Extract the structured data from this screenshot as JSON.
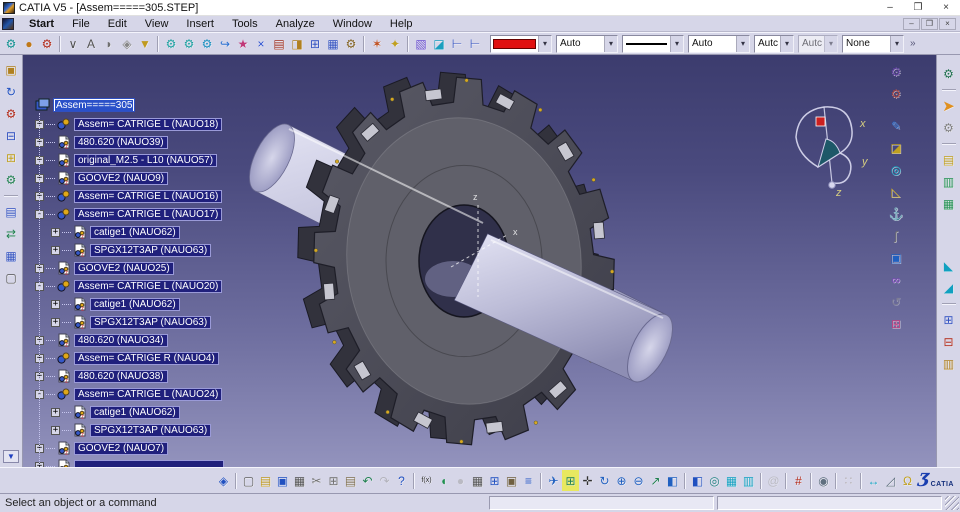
{
  "window": {
    "title": "CATIA V5 - [Assem=====305.STEP]",
    "min": "–",
    "restore": "❐",
    "close": "×"
  },
  "menu": {
    "items": [
      "Start",
      "File",
      "Edit",
      "View",
      "Insert",
      "Tools",
      "Analyze",
      "Window",
      "Help"
    ]
  },
  "glyphs": {
    "combo_arrow": "▾",
    "overflow_right": "»",
    "overflow_left": "▼",
    "expand": "+",
    "collapse": "-"
  },
  "toolbar_top": {
    "groups": [
      [
        {
          "n": "update-icon",
          "g": "⚙",
          "fg": "#0e8f8f"
        },
        {
          "n": "visual-sphere-icon",
          "g": "●",
          "fg": "#c07818"
        },
        {
          "n": "generate-gears-icon",
          "g": "⚙",
          "fg": "#b02818"
        }
      ],
      [
        {
          "n": "axis-snap-icon",
          "g": "∨",
          "fg": "#505050"
        },
        {
          "n": "text-annotation-icon",
          "g": "A",
          "fg": "#505050"
        },
        {
          "n": "callout-icon",
          "g": "◗",
          "fg": "#707070"
        },
        {
          "n": "clipping-icon",
          "g": "◈",
          "fg": "#888888"
        },
        {
          "n": "material-bucket-icon",
          "g": "▼",
          "fg": "#c09a20"
        }
      ],
      [
        {
          "n": "new-component-icon",
          "g": "⚙",
          "fg": "#1a9f9f"
        },
        {
          "n": "new-product-icon",
          "g": "⚙",
          "fg": "#1a9f9f"
        },
        {
          "n": "new-part-icon",
          "g": "⚙",
          "fg": "#1a8fbf"
        },
        {
          "n": "existing-component-icon",
          "g": "↪",
          "fg": "#2a6fd0"
        },
        {
          "n": "existing-with-positioning-icon",
          "g": "★",
          "fg": "#c03878"
        },
        {
          "n": "fast-multi-instantiation-icon",
          "g": "×",
          "fg": "#2a4fd0"
        },
        {
          "n": "catalog-book-icon",
          "g": "▤",
          "fg": "#a03020"
        },
        {
          "n": "smart-move-icon",
          "g": "◨",
          "fg": "#b08020"
        },
        {
          "n": "graph-tree-icon",
          "g": "⊞",
          "fg": "#3050c0"
        },
        {
          "n": "tree-window-icon",
          "g": "▦",
          "fg": "#3050c0"
        },
        {
          "n": "multi-instance-gear-icon",
          "g": "⚙",
          "fg": "#806020"
        }
      ],
      [
        {
          "n": "clash-icon",
          "g": "✶",
          "fg": "#c05020"
        },
        {
          "n": "sectioning-icon",
          "g": "✦",
          "fg": "#c0a020"
        }
      ],
      [
        {
          "n": "scene-box-icon",
          "g": "▧",
          "fg": "#6a4fd0"
        },
        {
          "n": "exploded-view-icon",
          "g": "◪",
          "fg": "#1a9fbf"
        },
        {
          "n": "structure-tree1-icon",
          "g": "⊢",
          "fg": "#3050c0"
        },
        {
          "n": "structure-tree2-icon",
          "g": "⊢",
          "fg": "#3050c0"
        }
      ]
    ],
    "combos": [
      {
        "n": "fill-color-combo",
        "kind": "color"
      },
      {
        "n": "opacity-combo",
        "value": "Auto"
      },
      {
        "n": "line-type-combo",
        "kind": "line"
      },
      {
        "n": "line-weight-combo",
        "value": "Auto"
      },
      {
        "n": "point-symbol-combo",
        "value": "Autc",
        "narrow": true
      },
      {
        "n": "render-style-combo",
        "value": "Autc",
        "narrow": true,
        "disabled": true
      },
      {
        "n": "layer-combo",
        "value": "None"
      }
    ]
  },
  "left_toolbar": {
    "icons": [
      {
        "n": "component-icon",
        "g": "▣",
        "fg": "#b08020"
      },
      {
        "n": "update-rotate-icon",
        "g": "↻",
        "fg": "#2050c0"
      },
      {
        "n": "part-gear-icon",
        "g": "⚙",
        "fg": "#b02818"
      },
      {
        "n": "product-structure-icon",
        "g": "⊟",
        "fg": "#3050c0"
      },
      {
        "n": "structure-bulb-icon",
        "g": "⊞",
        "fg": "#c0a020"
      },
      {
        "n": "constraints-gear-icon",
        "g": "⚙",
        "fg": "#208050"
      },
      {
        "sep": 1
      },
      {
        "n": "tree-edit-icon",
        "g": "▤",
        "fg": "#3050c0"
      },
      {
        "n": "replace-icon",
        "g": "⇄",
        "fg": "#208050"
      },
      {
        "n": "graph-list-icon",
        "g": "▦",
        "fg": "#3050c0"
      },
      {
        "n": "document-icon",
        "g": "▢",
        "fg": "#505050"
      }
    ]
  },
  "right_outer": {
    "icons": [
      {
        "n": "gears-pair-icon",
        "g": "⚙",
        "fg": "#207050"
      },
      {
        "sep": 1
      },
      {
        "n": "select-arrow-icon",
        "g": "➤",
        "fg": "#e09020",
        "big": 1
      },
      {
        "n": "gear-cursor-icon",
        "g": "⚙",
        "fg": "#808080"
      },
      {
        "sep": 1
      },
      {
        "n": "catalog-yellow-icon",
        "g": "▤",
        "fg": "#c0a020"
      },
      {
        "n": "catalog-green-icon",
        "g": "▥",
        "fg": "#209050"
      },
      {
        "n": "catalog-green2-icon",
        "g": "▦",
        "fg": "#209050"
      },
      {
        "gap": 40
      },
      {
        "n": "view-plane1-icon",
        "g": "◣",
        "fg": "#10a0c0"
      },
      {
        "n": "view-plane2-icon",
        "g": "◢",
        "fg": "#10a0c0"
      },
      {
        "sep": 1
      },
      {
        "n": "assembly-feature1-icon",
        "g": "⊞",
        "fg": "#3050c0"
      },
      {
        "n": "assembly-feature2-icon",
        "g": "⊟",
        "fg": "#b02818"
      },
      {
        "n": "assembly-symmetry-icon",
        "g": "▥",
        "fg": "#b08020"
      }
    ]
  },
  "right_inner": {
    "icons": [
      {
        "n": "dmu-fitting1-icon",
        "g": "⚙",
        "fg": "#6040a0"
      },
      {
        "n": "dmu-fitting2-icon",
        "g": "⚙",
        "fg": "#a04040"
      },
      {
        "gap": 10
      },
      {
        "n": "sphere-pencil-icon",
        "g": "✎",
        "fg": "#2060c0"
      },
      {
        "n": "light-box-icon",
        "g": "◪",
        "fg": "#c0a020"
      },
      {
        "n": "binocular-icon",
        "g": "◎",
        "fg": "#10a0c0"
      },
      {
        "n": "ruler-triangle-icon",
        "g": "◺",
        "fg": "#c0a020"
      },
      {
        "n": "anchor-icon",
        "g": "⚓",
        "fg": "#806020"
      },
      {
        "n": "paperclip-icon",
        "g": "∫",
        "fg": "#707070"
      },
      {
        "n": "window-pointer-icon",
        "g": "▣",
        "fg": "#2060c0"
      },
      {
        "n": "link-chain-icon",
        "g": "∞",
        "fg": "#8040c0"
      },
      {
        "n": "update-circle-icon",
        "g": "↺",
        "fg": "#909090",
        "d": 1
      },
      {
        "n": "gear-grid-icon",
        "g": "⊞",
        "fg": "#c04080"
      }
    ]
  },
  "tree": {
    "root": {
      "label": "Assem=====305"
    },
    "items": [
      {
        "label": "Assem= CATRIGE L (NAUO18)",
        "depth": 1,
        "exp": "+",
        "type": "asm"
      },
      {
        "label": "480.620 (NAUO39)",
        "depth": 1,
        "exp": "+",
        "type": "part"
      },
      {
        "label": "original_M2.5 - L10 (NAUO57)",
        "depth": 1,
        "exp": "+",
        "type": "part"
      },
      {
        "label": "GOOVE2 (NAUO9)",
        "depth": 1,
        "exp": "+",
        "type": "part"
      },
      {
        "label": "Assem= CATRIGE L (NAUO16)",
        "depth": 1,
        "exp": "+",
        "type": "asm"
      },
      {
        "label": "Assem= CATRIGE L (NAUO17)",
        "depth": 1,
        "exp": "-",
        "type": "asm"
      },
      {
        "label": "catige1 (NAUO62)",
        "depth": 2,
        "exp": "+",
        "type": "part"
      },
      {
        "label": "SPGX12T3AP (NAUO63)",
        "depth": 2,
        "exp": "+",
        "type": "part"
      },
      {
        "label": "GOOVE2 (NAUO25)",
        "depth": 1,
        "exp": "+",
        "type": "part"
      },
      {
        "label": "Assem= CATRIGE L (NAUO20)",
        "depth": 1,
        "exp": "-",
        "type": "asm"
      },
      {
        "label": "catige1 (NAUO62)",
        "depth": 2,
        "exp": "+",
        "type": "part"
      },
      {
        "label": "SPGX12T3AP (NAUO63)",
        "depth": 2,
        "exp": "+",
        "type": "part"
      },
      {
        "label": "480.620 (NAUO34)",
        "depth": 1,
        "exp": "+",
        "type": "part"
      },
      {
        "label": "Assem= CATRIGE R (NAUO4)",
        "depth": 1,
        "exp": "+",
        "type": "asm"
      },
      {
        "label": "480.620 (NAUO38)",
        "depth": 1,
        "exp": "+",
        "type": "part"
      },
      {
        "label": "Assem= CATRIGE L (NAUO24)",
        "depth": 1,
        "exp": "-",
        "type": "asm"
      },
      {
        "label": "catige1 (NAUO62)",
        "depth": 2,
        "exp": "+",
        "type": "part"
      },
      {
        "label": "SPGX12T3AP (NAUO63)",
        "depth": 2,
        "exp": "+",
        "type": "part"
      },
      {
        "label": "GOOVE2 (NAUO7)",
        "depth": 1,
        "exp": "+",
        "type": "part"
      },
      {
        "label": "",
        "depth": 1,
        "exp": "+",
        "type": "part",
        "clipped": true
      }
    ]
  },
  "compass": {
    "x": "x",
    "y": "y",
    "z": "z"
  },
  "viewport": {
    "axis_x": "x",
    "axis_z": "z"
  },
  "bottom_toolbar": {
    "groups": [
      [
        {
          "n": "workbench-icon",
          "g": "◈",
          "fg": "#2050c0"
        }
      ],
      [
        {
          "n": "new-icon",
          "g": "▢",
          "fg": "#606060"
        },
        {
          "n": "open-icon",
          "g": "▤",
          "fg": "#c09a20"
        },
        {
          "n": "save-icon",
          "g": "▣",
          "fg": "#2050c0"
        },
        {
          "n": "print-icon",
          "g": "▦",
          "fg": "#505050"
        },
        {
          "n": "cut-icon",
          "g": "✂",
          "fg": "#707070"
        },
        {
          "n": "copy-icon",
          "g": "⊞",
          "fg": "#707070"
        },
        {
          "n": "paste-icon",
          "g": "▤",
          "fg": "#807050"
        },
        {
          "n": "undo-icon",
          "g": "↶",
          "fg": "#208050"
        },
        {
          "n": "redo-icon",
          "g": "↷",
          "fg": "#909090",
          "d": 1
        },
        {
          "n": "whats-this-icon",
          "g": "?",
          "fg": "#2050c0"
        }
      ],
      [
        {
          "n": "knowledge-fx-icon",
          "g": "f(x)",
          "fg": "#303030"
        },
        {
          "n": "comment-icon",
          "g": "◖",
          "fg": "#209050"
        },
        {
          "n": "profile-icon",
          "g": "●",
          "fg": "#a0a0a0",
          "d": 1
        },
        {
          "n": "design-table-icon",
          "g": "▦",
          "fg": "#505050"
        },
        {
          "n": "relations-icon",
          "g": "⊞",
          "fg": "#2050c0"
        },
        {
          "n": "lock-icon",
          "g": "▣",
          "fg": "#706040"
        },
        {
          "n": "check-list-icon",
          "g": "≡",
          "fg": "#2050c0"
        }
      ],
      [
        {
          "n": "fly-icon",
          "g": "✈",
          "fg": "#2060c0"
        },
        {
          "n": "fit-all-icon",
          "g": "⊞",
          "fg": "#208050",
          "bg": "#e8e860"
        },
        {
          "n": "pan-icon",
          "g": "✛",
          "fg": "#303030"
        },
        {
          "n": "rotate-icon",
          "g": "↻",
          "fg": "#2060c0"
        },
        {
          "n": "zoom-in-icon",
          "g": "⊕",
          "fg": "#2060c0"
        },
        {
          "n": "zoom-out-icon",
          "g": "⊖",
          "fg": "#2060c0"
        },
        {
          "n": "normal-view-icon",
          "g": "↗",
          "fg": "#208050"
        },
        {
          "n": "multi-view-icon",
          "g": "◧",
          "fg": "#2060c0"
        }
      ],
      [
        {
          "n": "shading-cube-icon",
          "g": "◧",
          "fg": "#2050c0"
        },
        {
          "n": "render-style-cyl-icon",
          "g": "◎",
          "fg": "#208080"
        },
        {
          "n": "hide-show-icon",
          "g": "▦",
          "fg": "#10a0c0"
        },
        {
          "n": "swap-visible-icon",
          "g": "▥",
          "fg": "#10a0c0"
        }
      ],
      [
        {
          "n": "spin-icon",
          "g": "@",
          "fg": "#a0a0a0",
          "d": 1
        }
      ],
      [
        {
          "n": "axis-grid-icon",
          "g": "#",
          "fg": "#b02818"
        }
      ],
      [
        {
          "n": "camera-icon",
          "g": "◉",
          "fg": "#607080"
        }
      ],
      [
        {
          "n": "snap-points-icon",
          "g": "∷",
          "fg": "#e08020",
          "d": 1
        }
      ],
      [
        {
          "n": "measure-between-icon",
          "g": "↔",
          "fg": "#10a0c0"
        },
        {
          "n": "measure-item-icon",
          "g": "◿",
          "fg": "#607080"
        },
        {
          "n": "mass-properties-icon",
          "g": "Ω",
          "fg": "#c0a020"
        }
      ]
    ],
    "logo_mark": "Ʒ",
    "logo_text": "CATIA"
  },
  "status": {
    "message": "Select an object or a command"
  }
}
